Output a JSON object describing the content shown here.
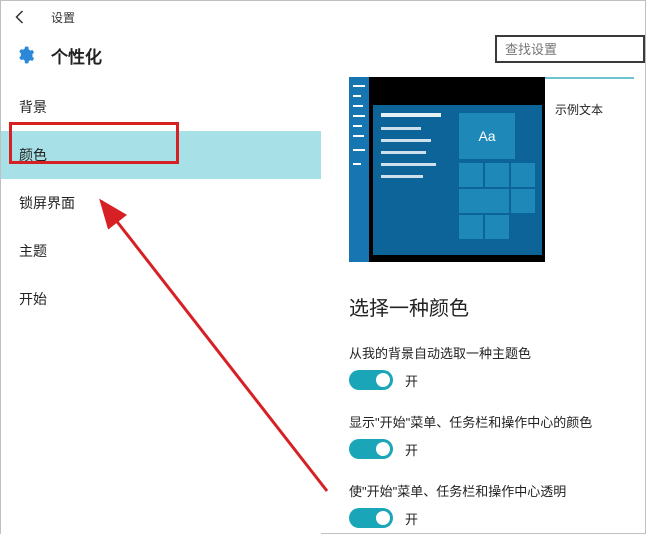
{
  "window": {
    "title": "设置"
  },
  "header": {
    "title": "个性化"
  },
  "search": {
    "placeholder": "查找设置"
  },
  "sidebar": {
    "items": [
      {
        "label": "背景"
      },
      {
        "label": "颜色"
      },
      {
        "label": "锁屏界面"
      },
      {
        "label": "主题"
      },
      {
        "label": "开始"
      }
    ],
    "selected_index": 1
  },
  "preview": {
    "tile_text": "Aa",
    "sample_text": "示例文本"
  },
  "content": {
    "section_title": "选择一种颜色",
    "options": [
      {
        "label": "从我的背景自动选取一种主题色",
        "state_text": "开"
      },
      {
        "label": "显示\"开始\"菜单、任务栏和操作中心的颜色",
        "state_text": "开"
      },
      {
        "label": "使\"开始\"菜单、任务栏和操作中心透明",
        "state_text": "开"
      }
    ]
  },
  "colors": {
    "accent": "#1aa6b8"
  }
}
